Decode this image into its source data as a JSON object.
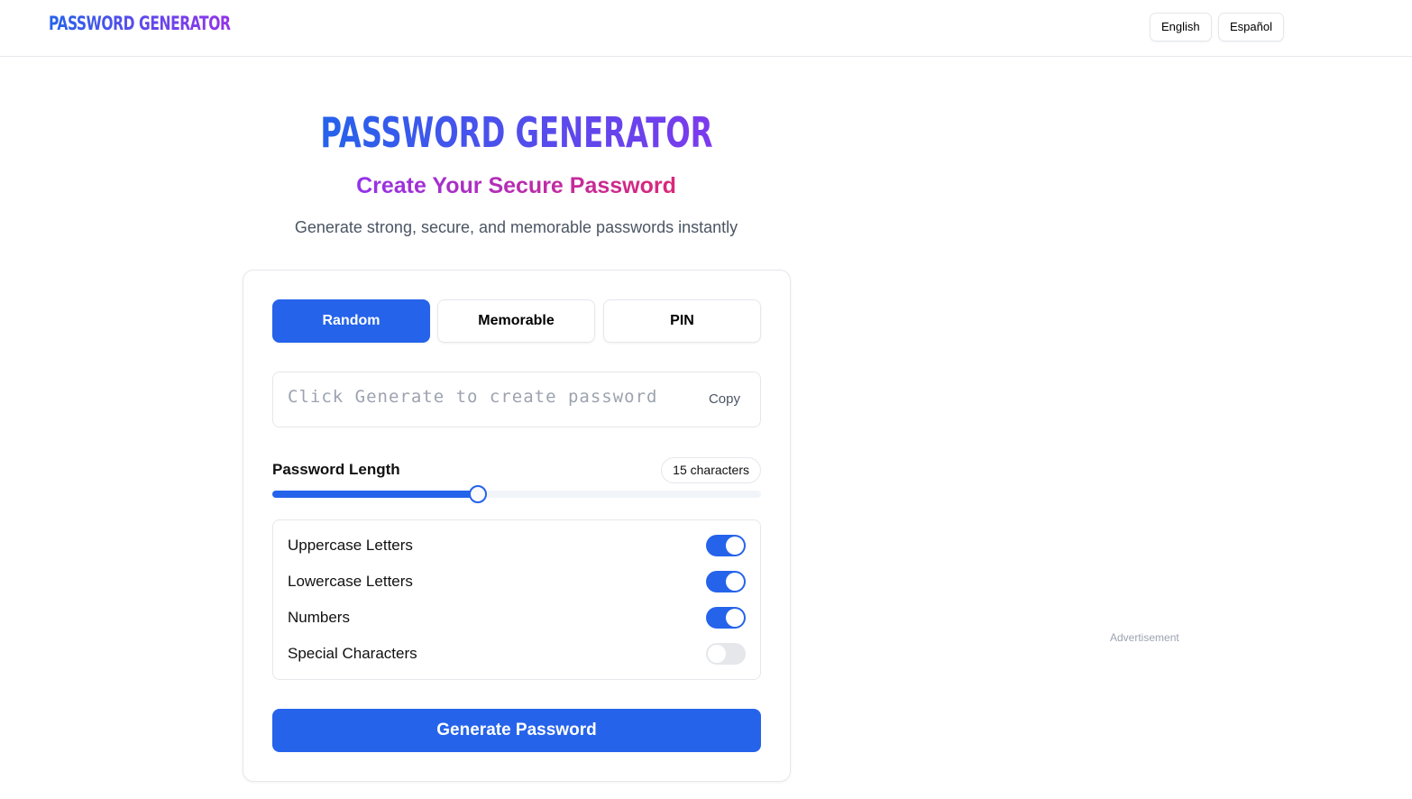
{
  "header": {
    "logo": "PASSWORD GENERATOR",
    "languages": [
      "English",
      "Español"
    ]
  },
  "hero": {
    "title": "PASSWORD GENERATOR",
    "subtitle": "Create Your Secure Password",
    "description": "Generate strong, secure, and memorable passwords instantly"
  },
  "tabs": [
    {
      "label": "Random",
      "active": true
    },
    {
      "label": "Memorable",
      "active": false
    },
    {
      "label": "PIN",
      "active": false
    }
  ],
  "password": {
    "placeholder": "Click Generate to create password",
    "value": "",
    "copy_label": "Copy"
  },
  "length": {
    "label": "Password Length",
    "badge": "15 characters",
    "value": 15,
    "fill_fraction": 0.42
  },
  "options": [
    {
      "label": "Uppercase Letters",
      "enabled": true
    },
    {
      "label": "Lowercase Letters",
      "enabled": true
    },
    {
      "label": "Numbers",
      "enabled": true
    },
    {
      "label": "Special Characters",
      "enabled": false
    }
  ],
  "generate_label": "Generate Password",
  "ad_label": "Advertisement",
  "colors": {
    "accent": "#2563eb",
    "gradient_start": "#2563eb",
    "gradient_end": "#9333ea",
    "subtitle_end": "#db2777"
  }
}
